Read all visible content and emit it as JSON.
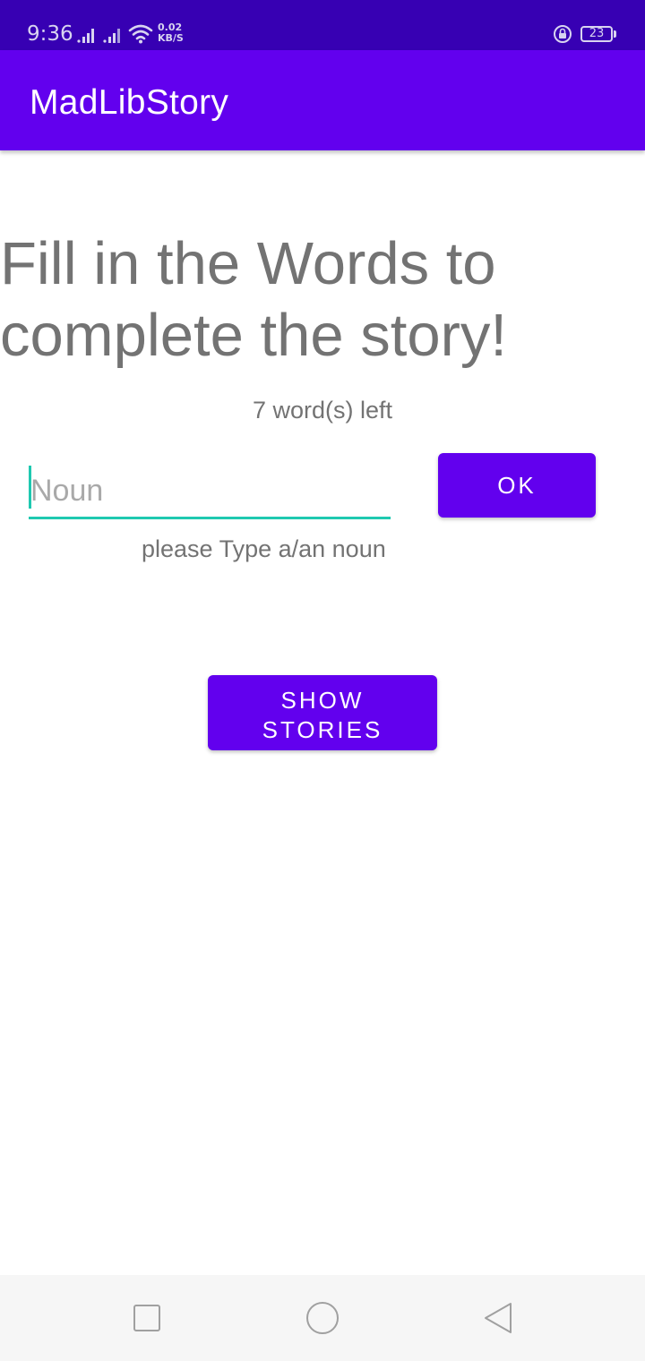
{
  "status_bar": {
    "time": "9:36",
    "net_speed_value": "0.02",
    "net_speed_unit": "KB/S",
    "battery_level": "23"
  },
  "app_bar": {
    "title": "MadLibStory"
  },
  "main": {
    "headline_line1": "Fill in the Words to",
    "headline_line2": "complete the story!",
    "words_left": "7 word(s) left",
    "input_placeholder": "Noun",
    "input_value": "",
    "ok_label": "OK",
    "hint": "please Type a/an noun",
    "show_stories_line1": "SHOW",
    "show_stories_line2": "STORIES"
  },
  "colors": {
    "status_bar": "#3700b3",
    "primary": "#6200ee",
    "accent": "#1fc9b0",
    "text_gray": "#737373"
  },
  "nav_bar": {
    "icons": [
      "recents-icon",
      "home-icon",
      "back-icon"
    ]
  }
}
